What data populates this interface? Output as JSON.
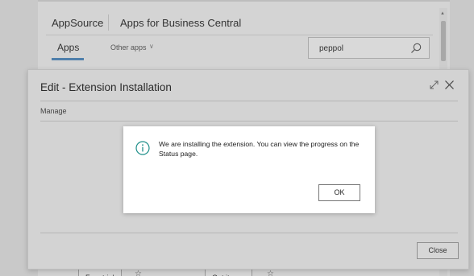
{
  "background": {
    "brand": "AppSource",
    "title": "Apps for Business Central",
    "tab_apps": "Apps",
    "other_apps": "Other apps",
    "search_value": "peppol",
    "btn_free_trial": "Free trial",
    "btn_get_it_now": "Get it now"
  },
  "dialog": {
    "title": "Edit - Extension Installation",
    "section": "Manage",
    "close_button": "Close"
  },
  "message": {
    "text": "We are installing the extension. You can view the progress on the Status page.",
    "ok_button": "OK"
  },
  "colors": {
    "accent": "#4f7fab",
    "info_icon": "#1f8f8a"
  },
  "icons": {
    "search": "search-icon",
    "expand": "expand-icon",
    "close": "close-icon",
    "info": "info-icon",
    "chevron": "chevron-down-icon",
    "star": "star-icon"
  }
}
